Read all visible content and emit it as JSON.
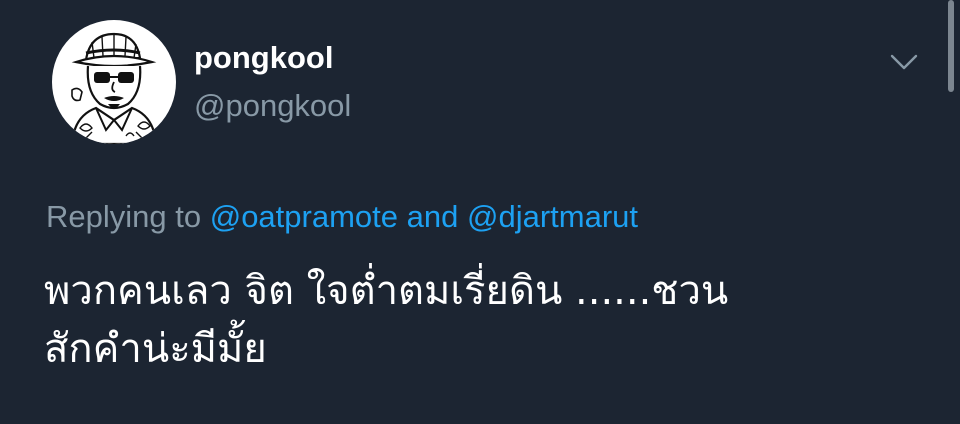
{
  "tweet": {
    "display_name": "pongkool",
    "handle": "@pongkool",
    "replying_prefix": "Replying to",
    "reply_to_1": "@oatpramote",
    "reply_conjunction": "and",
    "reply_to_2": "@djartmarut",
    "text_line_1": "พวกคนเลว จิต ใจต่ำตมเรี่ยดิน ......ชวน",
    "text_line_2": "สักคำน่ะมีมั้ย"
  },
  "icons": {
    "menu": "chevron-down-icon",
    "avatar": "cartoon-portrait"
  },
  "colors": {
    "background": "#1c2532",
    "name": "#ffffff",
    "muted": "#8899a6",
    "link": "#1da1f2"
  }
}
